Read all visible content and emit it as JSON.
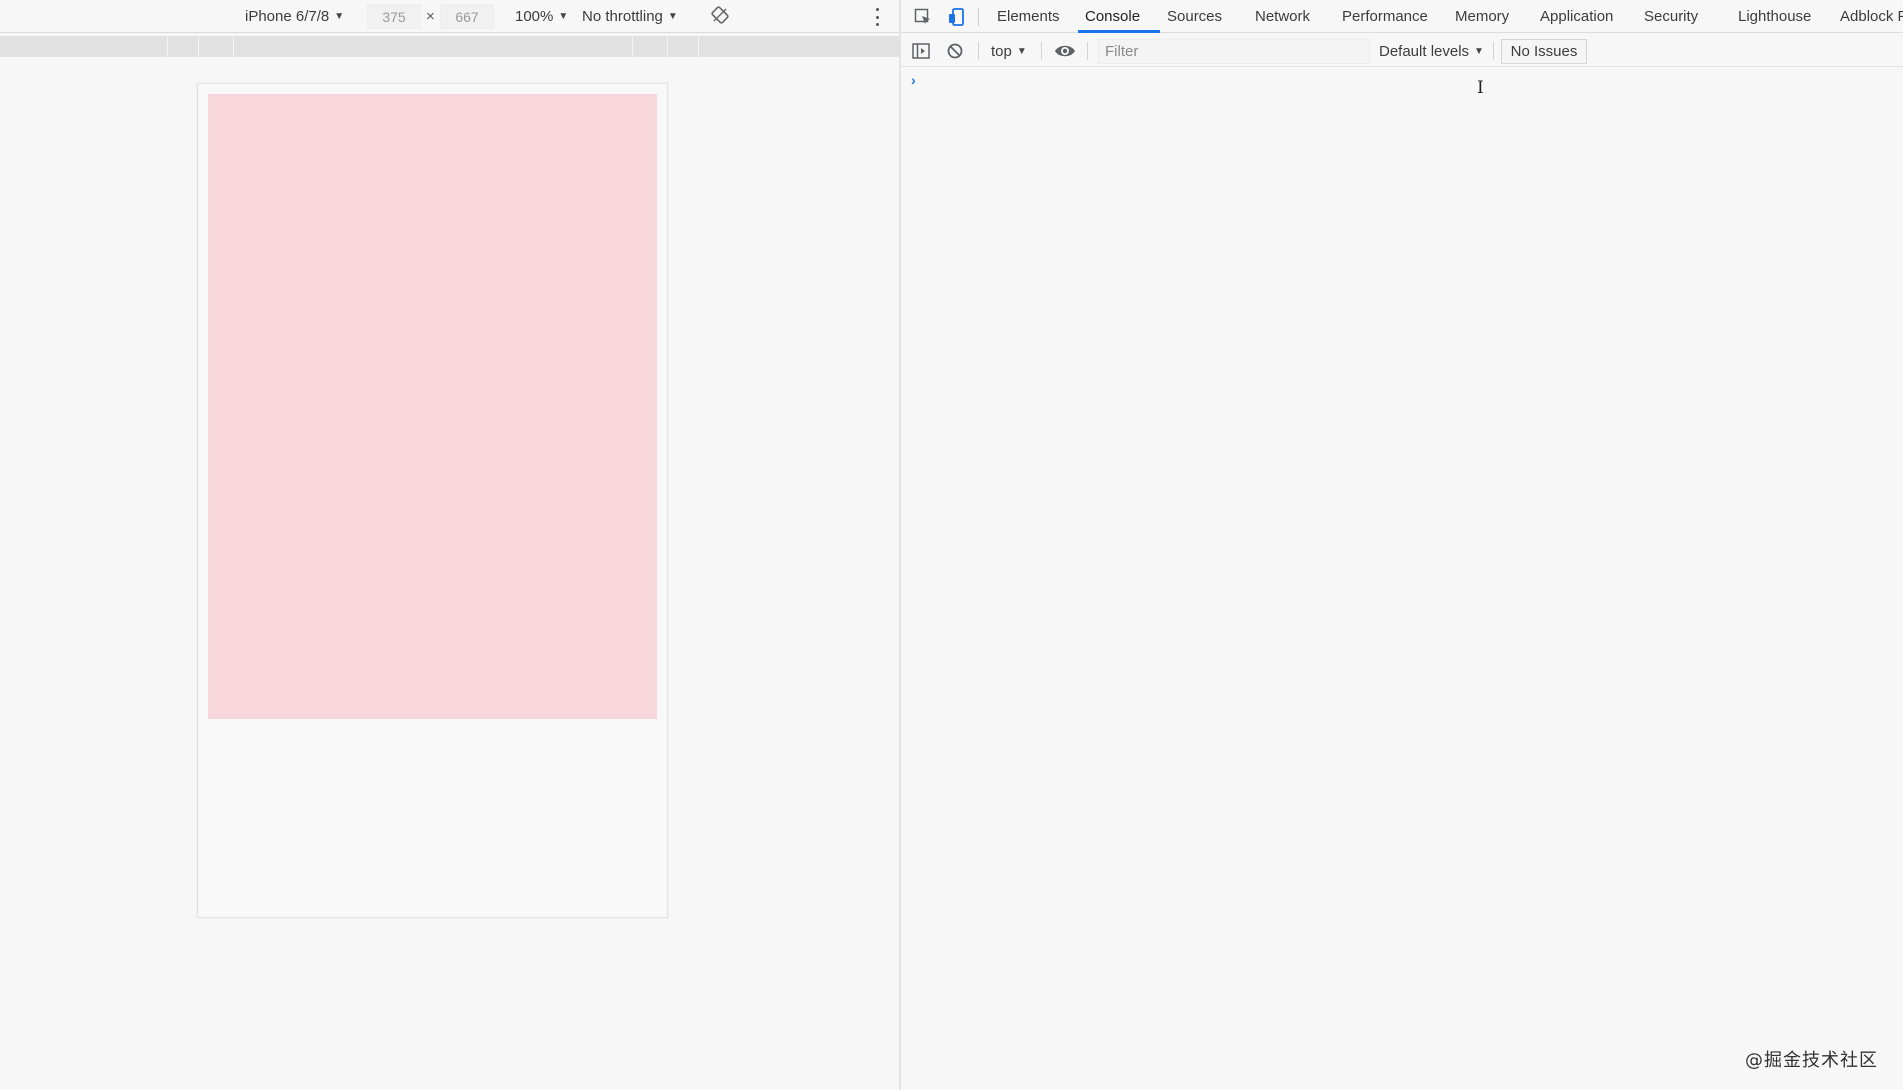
{
  "device_toolbar": {
    "device_name": "iPhone 6/7/8",
    "width_value": "375",
    "height_value": "667",
    "dim_separator": "×",
    "zoom": "100%",
    "throttling": "No throttling",
    "caret": "▼"
  },
  "devtools": {
    "tabs": [
      {
        "label": "Elements",
        "active": false
      },
      {
        "label": "Console",
        "active": true
      },
      {
        "label": "Sources",
        "active": false
      },
      {
        "label": "Network",
        "active": false
      },
      {
        "label": "Performance",
        "active": false
      },
      {
        "label": "Memory",
        "active": false
      },
      {
        "label": "Application",
        "active": false
      },
      {
        "label": "Security",
        "active": false
      },
      {
        "label": "Lighthouse",
        "active": false
      },
      {
        "label": "Adblock P",
        "active": false
      }
    ],
    "console_toolbar": {
      "context": "top",
      "filter_placeholder": "Filter",
      "levels": "Default levels",
      "issues": "No Issues"
    },
    "prompt_symbol": "›",
    "cursor_glyph": "I"
  },
  "watermark": "@掘金技术社区",
  "colors": {
    "accent": "#1a73e8",
    "pink_block": "#f8d7dc",
    "background": "#f7f7f7"
  }
}
